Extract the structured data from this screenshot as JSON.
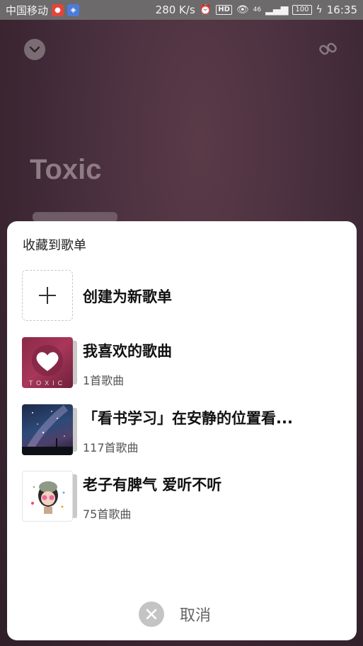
{
  "status_bar": {
    "carrier": "中国移动",
    "net_speed": "280 K/s",
    "hd_label": "HD",
    "network_label": "46",
    "battery_level": "100",
    "time": "16:35"
  },
  "player": {
    "song_title": "Toxic"
  },
  "sheet": {
    "title": "收藏到歌单",
    "create_label": "创建为新歌单",
    "playlists": [
      {
        "name": "我喜欢的歌曲",
        "count": "1首歌曲",
        "cover_text": "TOXIC"
      },
      {
        "name": "「看书学习」在安静的位置看...",
        "count": "117首歌曲"
      },
      {
        "name": "老子有脾气 爱听不听",
        "count": "75首歌曲"
      }
    ],
    "cancel_label": "取消"
  },
  "icons": {
    "collapse": "chevron-down-icon",
    "share_link": "link-icon",
    "create": "plus-icon",
    "cancel": "close-icon",
    "liked": "heart-icon"
  }
}
